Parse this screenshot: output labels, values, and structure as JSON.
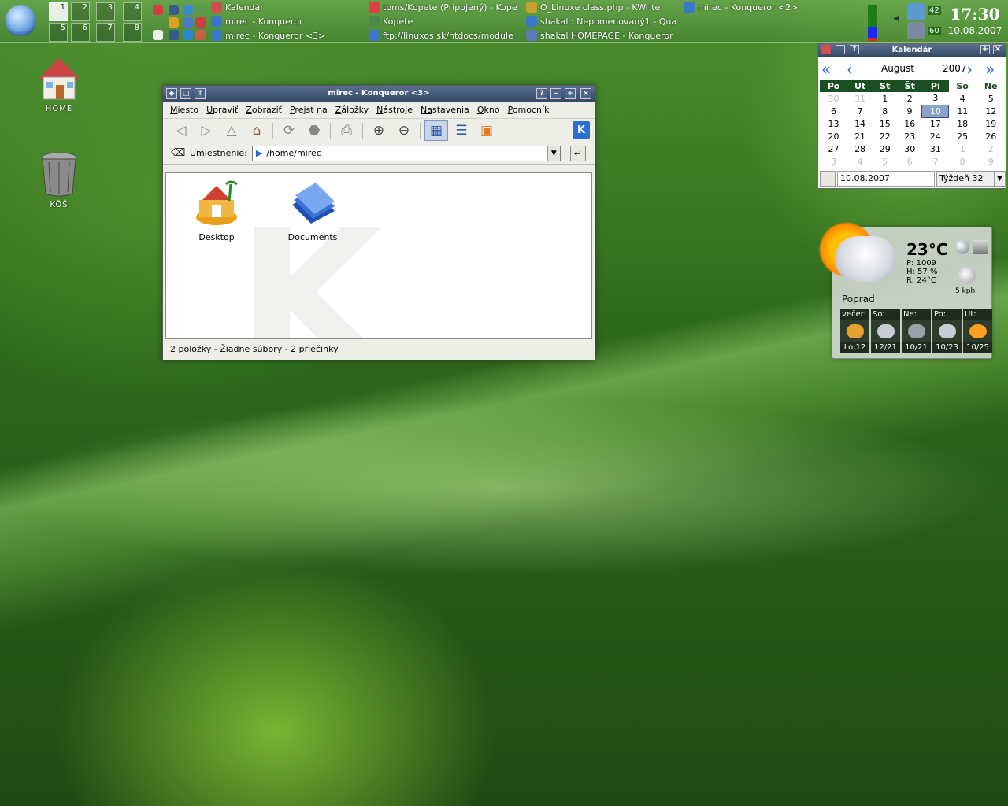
{
  "panel": {
    "pager": [
      "1",
      "2",
      "3",
      "4",
      "5",
      "6",
      "7",
      "8"
    ],
    "tasks": [
      {
        "label": "Kalendár",
        "color": "#d05050"
      },
      {
        "label": "mirec - Konqueror",
        "color": "#3a78c8"
      },
      {
        "label": "mirec - Konqueror <3>",
        "color": "#3a78c8"
      },
      {
        "label": "toms/Kopete (Pripojený) - Kope",
        "color": "#e04040"
      },
      {
        "label": "Kopete",
        "color": "#4a8a4a"
      },
      {
        "label": "ftp://linuxos.sk/htdocs/module",
        "color": "#3a78c8"
      },
      {
        "label": "O_Linuxe class.php - KWrite",
        "color": "#c8a030"
      },
      {
        "label": "shakal : Nepomenovaný1 - Qua",
        "color": "#3a78c8"
      },
      {
        "label": "shakal HOMEPAGE - Konqueror",
        "color": "#5a7ab8"
      },
      {
        "label": "mirec - Konqueror <2>",
        "color": "#3a78c8"
      }
    ],
    "tray_numbers": [
      "42",
      "60"
    ],
    "clock_time": "17:30",
    "clock_date": "10.08.2007"
  },
  "desktop_icons": [
    {
      "label": "HOME"
    },
    {
      "label": "KÔŠ"
    }
  ],
  "konqueror": {
    "title": "mirec - Konqueror <3>",
    "menu": [
      {
        "u": "M",
        "rest": "iesto"
      },
      {
        "u": "U",
        "rest": "praviť"
      },
      {
        "u": "Z",
        "rest": "obraziť"
      },
      {
        "u": "P",
        "rest": "rejsť na"
      },
      {
        "u": "Z",
        "rest": "áložky"
      },
      {
        "u": "N",
        "rest": "ástroje"
      },
      {
        "u": "Na",
        "rest": "stavenia"
      },
      {
        "u": "O",
        "rest": "kno"
      },
      {
        "u": "P",
        "rest": "omocník"
      }
    ],
    "location_label": "Umiestnenie:",
    "location_value": "/home/mirec",
    "files": [
      {
        "name": "Desktop"
      },
      {
        "name": "Documents"
      }
    ],
    "status": "2 položky - Žiadne súbory - 2 priečinky"
  },
  "calendar": {
    "title": "Kalendár",
    "month": "August",
    "year": "2007",
    "weekdays": [
      "Po",
      "Ut",
      "St",
      "Št",
      "Pi",
      "So",
      "Ne"
    ],
    "weeks": [
      [
        "30",
        "31",
        "1",
        "2",
        "3",
        "4",
        "5"
      ],
      [
        "6",
        "7",
        "8",
        "9",
        "10",
        "11",
        "12"
      ],
      [
        "13",
        "14",
        "15",
        "16",
        "17",
        "18",
        "19"
      ],
      [
        "20",
        "21",
        "22",
        "23",
        "24",
        "25",
        "26"
      ],
      [
        "27",
        "28",
        "29",
        "30",
        "31",
        "1",
        "2"
      ],
      [
        "3",
        "4",
        "5",
        "6",
        "7",
        "8",
        "9"
      ]
    ],
    "selected_day": "10",
    "date_input": "10.08.2007",
    "week_label": "Týždeň 32"
  },
  "weather": {
    "temp": "23°C",
    "pressure": "P: 1009",
    "humidity": "H: 57 %",
    "real": "R: 24°C",
    "city": "Poprad",
    "wind": "5 kph",
    "forecast": [
      {
        "day": "večer:",
        "value": "Lo:12",
        "icon": "#e8a030"
      },
      {
        "day": "So:",
        "value": "12/21",
        "icon": "#c8ccd4"
      },
      {
        "day": "Ne:",
        "value": "10/21",
        "icon": "#9aa0aa"
      },
      {
        "day": "Po:",
        "value": "10/23",
        "icon": "#c8ccd4"
      },
      {
        "day": "Ut:",
        "value": "10/25",
        "icon": "#ffa020"
      }
    ]
  }
}
